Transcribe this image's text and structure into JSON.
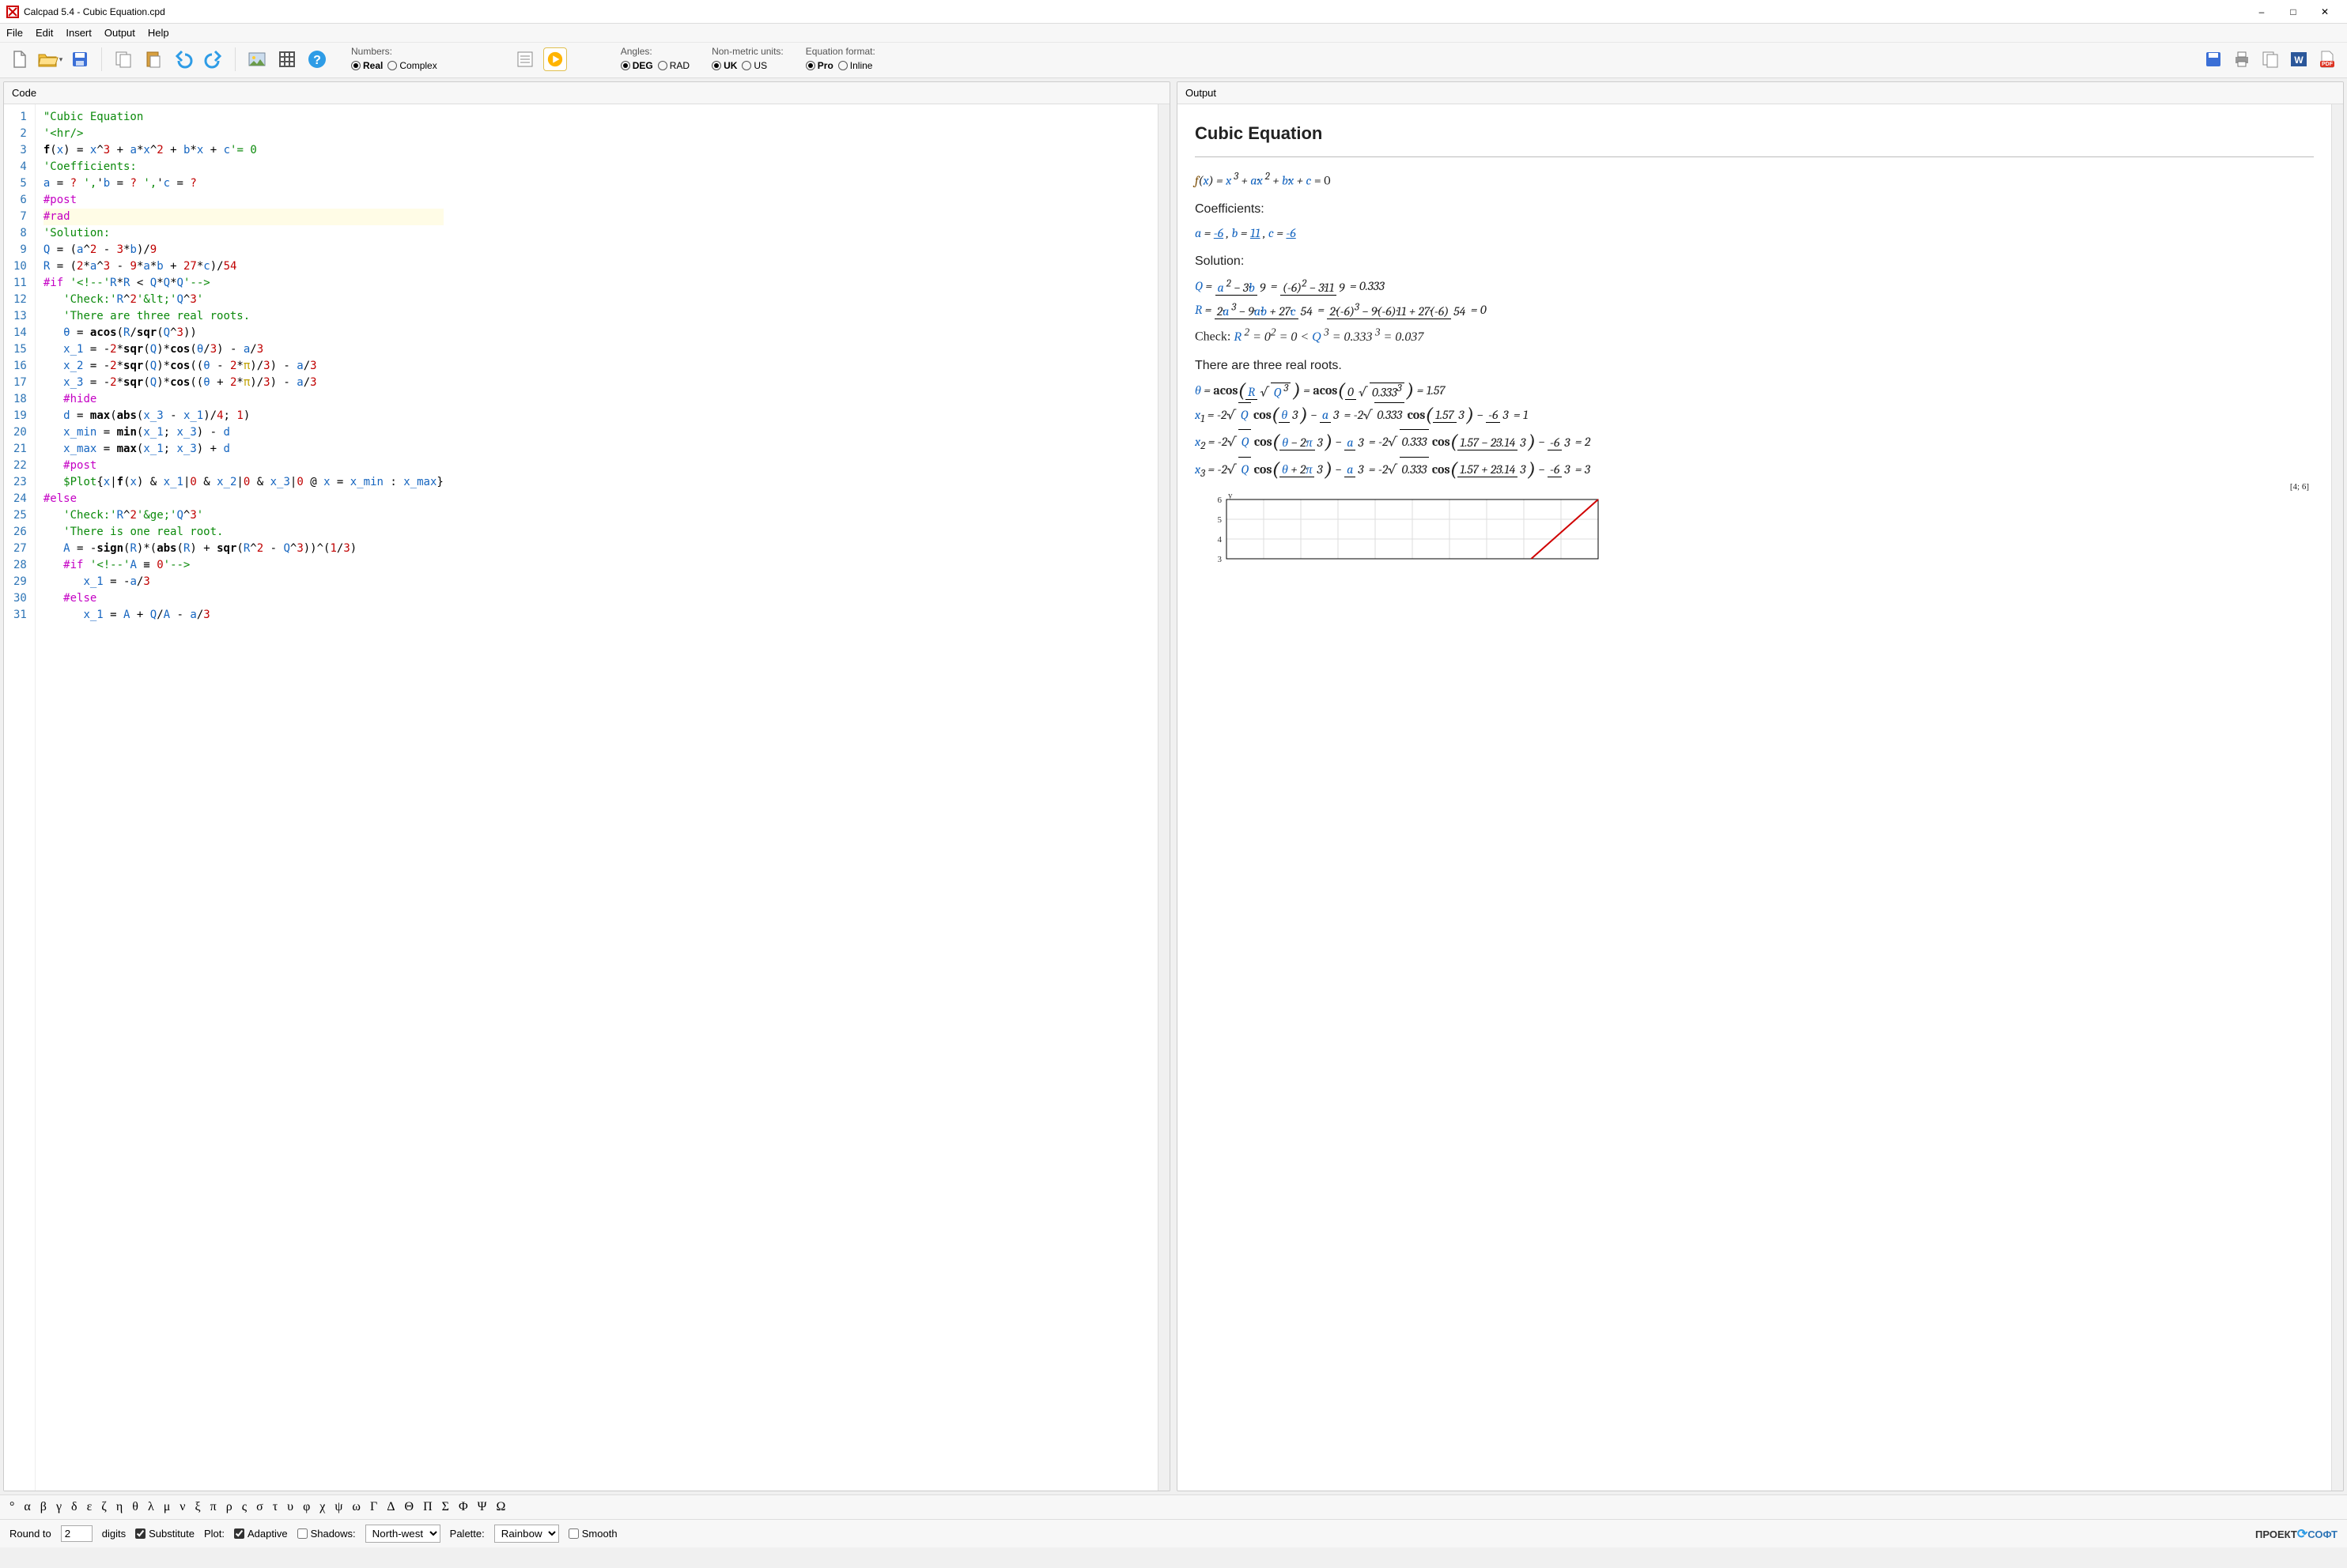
{
  "app": {
    "title": "Calcpad 5.4 - Cubic Equation.cpd"
  },
  "menu": [
    "File",
    "Edit",
    "Insert",
    "Output",
    "Help"
  ],
  "toolbar": {
    "numbers_label": "Numbers:",
    "numbers_opts": [
      "Real",
      "Complex"
    ],
    "numbers_sel": "Real",
    "angles_label": "Angles:",
    "angles_opts": [
      "DEG",
      "RAD"
    ],
    "angles_sel": "DEG",
    "units_label": "Non-metric units:",
    "units_opts": [
      "UK",
      "US"
    ],
    "units_sel": "UK",
    "eqformat_label": "Equation format:",
    "eqformat_opts": [
      "Pro",
      "Inline"
    ],
    "eqformat_sel": "Pro"
  },
  "panes": {
    "code_label": "Code",
    "output_label": "Output"
  },
  "code_lines": [
    {
      "n": 1,
      "html": "<span class='c-str'>\"Cubic Equation</span>"
    },
    {
      "n": 2,
      "html": "<span class='c-str'>'&lt;hr/&gt;</span>"
    },
    {
      "n": 3,
      "html": "<span class='c-func'>f</span>(<span class='c-var'>x</span>) = <span class='c-var'>x</span>^<span class='c-num'>3</span> + <span class='c-var'>a</span>*<span class='c-var'>x</span>^<span class='c-num'>2</span> + <span class='c-var'>b</span>*<span class='c-var'>x</span> + <span class='c-var'>c</span><span class='c-str'>'= 0</span>"
    },
    {
      "n": 4,
      "html": "<span class='c-str'>'Coefficients:</span>"
    },
    {
      "n": 5,
      "html": "<span class='c-var'>a</span> = <span class='c-num'>?</span> <span class='c-str'>',</span>'<span class='c-var'>b</span> = <span class='c-num'>?</span> <span class='c-str'>',</span>'<span class='c-var'>c</span> = <span class='c-num'>?</span>"
    },
    {
      "n": 6,
      "html": "<span class='c-kw'>#post</span>"
    },
    {
      "n": 7,
      "html": "<span class='c-kw'>#rad</span>",
      "hl": true
    },
    {
      "n": 8,
      "html": "<span class='c-str'>'Solution:</span>"
    },
    {
      "n": 9,
      "html": "<span class='c-var'>Q</span> = (<span class='c-var'>a</span>^<span class='c-num'>2</span> - <span class='c-num'>3</span>*<span class='c-var'>b</span>)/<span class='c-num'>9</span>"
    },
    {
      "n": 10,
      "html": "<span class='c-var'>R</span> = (<span class='c-num'>2</span>*<span class='c-var'>a</span>^<span class='c-num'>3</span> - <span class='c-num'>9</span>*<span class='c-var'>a</span>*<span class='c-var'>b</span> + <span class='c-num'>27</span>*<span class='c-var'>c</span>)/<span class='c-num'>54</span>"
    },
    {
      "n": 11,
      "html": "<span class='c-kw'>#if</span> <span class='c-str'>'&lt;!--'</span><span class='c-var'>R</span>*<span class='c-var'>R</span> &lt; <span class='c-var'>Q</span>*<span class='c-var'>Q</span>*<span class='c-var'>Q</span><span class='c-str'>'--&gt;</span>"
    },
    {
      "n": 12,
      "html": "   <span class='c-str'>'Check:'</span><span class='c-var'>R</span>^<span class='c-num'>2</span><span class='c-str'>'&amp;lt;'</span><span class='c-var'>Q</span>^<span class='c-num'>3</span><span class='c-str'>'</span>"
    },
    {
      "n": 13,
      "html": "   <span class='c-str'>'There are three real roots.</span>"
    },
    {
      "n": 14,
      "html": "   <span class='c-var'>θ</span> = <span class='c-func'>acos</span>(<span class='c-var'>R</span>/<span class='c-func'>sqr</span>(<span class='c-var'>Q</span>^<span class='c-num'>3</span>))"
    },
    {
      "n": 15,
      "html": "   <span class='c-var'>x_1</span> = -<span class='c-num'>2</span>*<span class='c-func'>sqr</span>(<span class='c-var'>Q</span>)*<span class='c-func'>cos</span>(<span class='c-var'>θ</span>/<span class='c-num'>3</span>) - <span class='c-var'>a</span>/<span class='c-num'>3</span>"
    },
    {
      "n": 16,
      "html": "   <span class='c-var'>x_2</span> = -<span class='c-num'>2</span>*<span class='c-func'>sqr</span>(<span class='c-var'>Q</span>)*<span class='c-func'>cos</span>((<span class='c-var'>θ</span> - <span class='c-num'>2</span>*<span class='c-sym'>π</span>)/<span class='c-num'>3</span>) - <span class='c-var'>a</span>/<span class='c-num'>3</span>"
    },
    {
      "n": 17,
      "html": "   <span class='c-var'>x_3</span> = -<span class='c-num'>2</span>*<span class='c-func'>sqr</span>(<span class='c-var'>Q</span>)*<span class='c-func'>cos</span>((<span class='c-var'>θ</span> + <span class='c-num'>2</span>*<span class='c-sym'>π</span>)/<span class='c-num'>3</span>) - <span class='c-var'>a</span>/<span class='c-num'>3</span>"
    },
    {
      "n": 18,
      "html": "   <span class='c-kw'>#hide</span>"
    },
    {
      "n": 19,
      "html": "   <span class='c-var'>d</span> = <span class='c-func'>max</span>(<span class='c-func'>abs</span>(<span class='c-var'>x_3</span> - <span class='c-var'>x_1</span>)/<span class='c-num'>4</span>; <span class='c-num'>1</span>)"
    },
    {
      "n": 20,
      "html": "   <span class='c-var'>x_min</span> = <span class='c-func'>min</span>(<span class='c-var'>x_1</span>; <span class='c-var'>x_3</span>) - <span class='c-var'>d</span>"
    },
    {
      "n": 21,
      "html": "   <span class='c-var'>x_max</span> = <span class='c-func'>max</span>(<span class='c-var'>x_1</span>; <span class='c-var'>x_3</span>) + <span class='c-var'>d</span>"
    },
    {
      "n": 22,
      "html": "   <span class='c-kw'>#post</span>"
    },
    {
      "n": 23,
      "html": "   <span class='c-plot'>$Plot</span>{<span class='c-var'>x</span>|<span class='c-func'>f</span>(<span class='c-var'>x</span>) &amp; <span class='c-var'>x_1</span>|<span class='c-num'>0</span> &amp; <span class='c-var'>x_2</span>|<span class='c-num'>0</span> &amp; <span class='c-var'>x_3</span>|<span class='c-num'>0</span> @ <span class='c-var'>x</span> = <span class='c-var'>x_min</span> : <span class='c-var'>x_max</span>}"
    },
    {
      "n": 24,
      "html": "<span class='c-kw'>#else</span>"
    },
    {
      "n": 25,
      "html": "   <span class='c-str'>'Check:'</span><span class='c-var'>R</span>^<span class='c-num'>2</span><span class='c-str'>'&amp;ge;'</span><span class='c-var'>Q</span>^<span class='c-num'>3</span><span class='c-str'>'</span>"
    },
    {
      "n": 26,
      "html": "   <span class='c-str'>'There is one real root.</span>"
    },
    {
      "n": 27,
      "html": "   <span class='c-var'>A</span> = -<span class='c-func'>sign</span>(<span class='c-var'>R</span>)*(<span class='c-func'>abs</span>(<span class='c-var'>R</span>) + <span class='c-func'>sqr</span>(<span class='c-var'>R</span>^<span class='c-num'>2</span> - <span class='c-var'>Q</span>^<span class='c-num'>3</span>))^(<span class='c-num'>1</span>/<span class='c-num'>3</span>)"
    },
    {
      "n": 28,
      "html": "   <span class='c-kw'>#if</span> <span class='c-str'>'&lt;!--'</span><span class='c-var'>A</span> ≡ <span class='c-num'>0</span><span class='c-str'>'--&gt;</span>"
    },
    {
      "n": 29,
      "html": "      <span class='c-var'>x_1</span> = -<span class='c-var'>a</span>/<span class='c-num'>3</span>"
    },
    {
      "n": 30,
      "html": "   <span class='c-kw'>#else</span>"
    },
    {
      "n": 31,
      "html": "      <span class='c-var'>x_1</span> = <span class='c-var'>A</span> + <span class='c-var'>Q</span>/<span class='c-var'>A</span> - <span class='c-var'>a</span>/<span class='c-num'>3</span>"
    }
  ],
  "output": {
    "title": "Cubic Equation",
    "eq_def": "f(x) = x³ + a·x² + b·x + c = 0",
    "coeff_label": "Coefficients:",
    "a": "-6",
    "b": "11",
    "c": "-6",
    "sol_label": "Solution:",
    "Q": "0.333",
    "R": "0",
    "check_text": "Check:",
    "R2": "0",
    "R2_full": "0²",
    "R2_val": "0",
    "Q3": "0.333³",
    "Q3_val": "0.037",
    "three_roots": "There are three real roots.",
    "theta": "1.57",
    "x1": "1",
    "x2": "2",
    "x3": "3",
    "plot_coord": "[4; 6]"
  },
  "chart_data": {
    "type": "line",
    "title": "",
    "xlabel": "",
    "ylabel": "y",
    "xlim": [
      0,
      4
    ],
    "ylim": [
      3,
      6
    ],
    "y_ticks": [
      3,
      4,
      5,
      6
    ],
    "x": [
      3.3,
      4.0
    ],
    "y": [
      3.0,
      6.0
    ],
    "series": [
      {
        "name": "f(x)",
        "color": "#d00000"
      }
    ]
  },
  "greek": [
    "°",
    "α",
    "β",
    "γ",
    "δ",
    "ε",
    "ζ",
    "η",
    "θ",
    "λ",
    "μ",
    "ν",
    "ξ",
    "π",
    "ρ",
    "ς",
    "σ",
    "τ",
    "υ",
    "φ",
    "χ",
    "ψ",
    "ω",
    "Γ",
    "Δ",
    "Θ",
    "Π",
    "Σ",
    "Φ",
    "Ψ",
    "Ω"
  ],
  "status": {
    "round_label": "Round to",
    "round_val": "2",
    "digits_label": "digits",
    "substitute": "Substitute",
    "plot_label": "Plot:",
    "adaptive": "Adaptive",
    "shadows": "Shadows:",
    "shadow_sel": "North-west",
    "palette_label": "Palette:",
    "palette_sel": "Rainbow",
    "smooth": "Smooth",
    "footer": "ПРОЕКТ",
    "footer2": "СОФТ"
  }
}
